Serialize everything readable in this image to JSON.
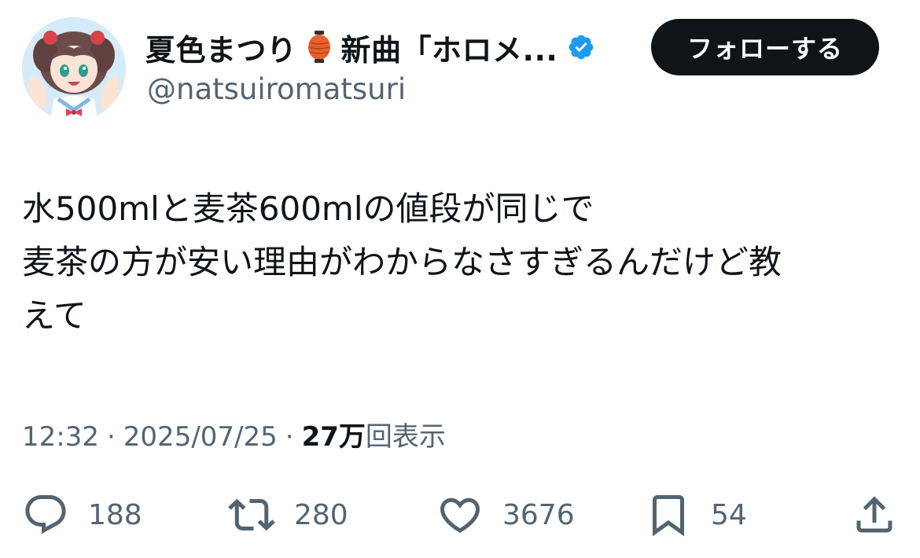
{
  "user": {
    "display_name": "夏色まつり",
    "name_suffix": "新曲「ホロメ...",
    "handle": "@natsuiromatsuri",
    "avatar_icon": "avatar-image",
    "lantern_icon": "red-lantern-icon",
    "verified_icon": "verified-badge-icon",
    "verified_color": "#1d9bf0"
  },
  "follow_button": {
    "label": "フォローする"
  },
  "tweet": {
    "lines": [
      "水500mlと麦茶600mlの値段が同じで",
      "麦茶の方が安い理由がわからなさすぎるんだけど教",
      "えて"
    ]
  },
  "meta": {
    "time": "12:32",
    "separator": "·",
    "date": "2025/07/25",
    "views_count": "27万",
    "views_label": "回表示"
  },
  "actions": {
    "reply": {
      "icon": "reply-bubble-icon",
      "count": "188"
    },
    "retweet": {
      "icon": "retweet-icon",
      "count": "280"
    },
    "like": {
      "icon": "heart-icon",
      "count": "3676"
    },
    "bookmark": {
      "icon": "bookmark-icon",
      "count": "54"
    },
    "share": {
      "icon": "share-icon"
    }
  },
  "colors": {
    "text_primary": "#0f1419",
    "text_secondary": "#536471",
    "button_bg": "#0f1419",
    "button_text": "#ffffff",
    "lantern": "#e8602c"
  }
}
